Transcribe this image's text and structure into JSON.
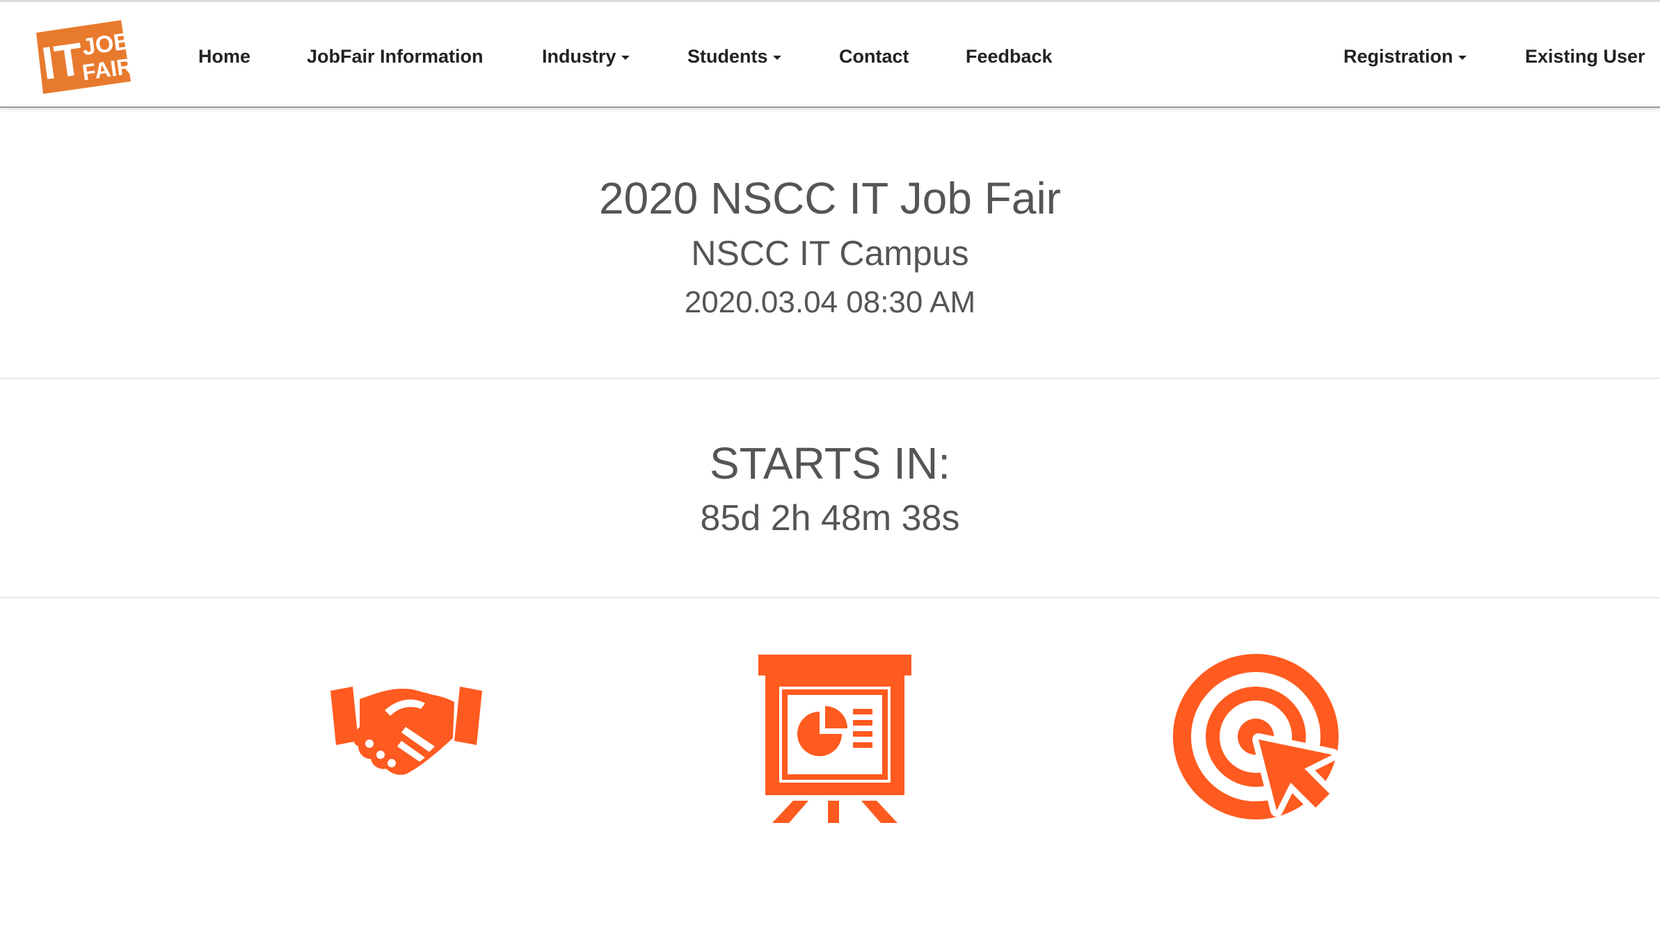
{
  "brand": {
    "logo_line1": "IT",
    "logo_line2": "JOB",
    "logo_line3": "FAIR",
    "accent_color": "#ff5a1f",
    "logo_color": "#e87a2e"
  },
  "nav": {
    "home": "Home",
    "jobfair_info": "JobFair Information",
    "industry": "Industry",
    "students": "Students",
    "contact": "Contact",
    "feedback": "Feedback",
    "registration": "Registration",
    "existing_user": "Existing User"
  },
  "event": {
    "title": "2020 NSCC IT Job Fair",
    "location": "NSCC IT Campus",
    "datetime": "2020.03.04 08:30 AM"
  },
  "countdown": {
    "label": "STARTS IN:",
    "value": "85d 2h 48m 38s"
  },
  "features": {
    "icons": [
      "handshake-icon",
      "presentation-icon",
      "target-click-icon"
    ]
  }
}
